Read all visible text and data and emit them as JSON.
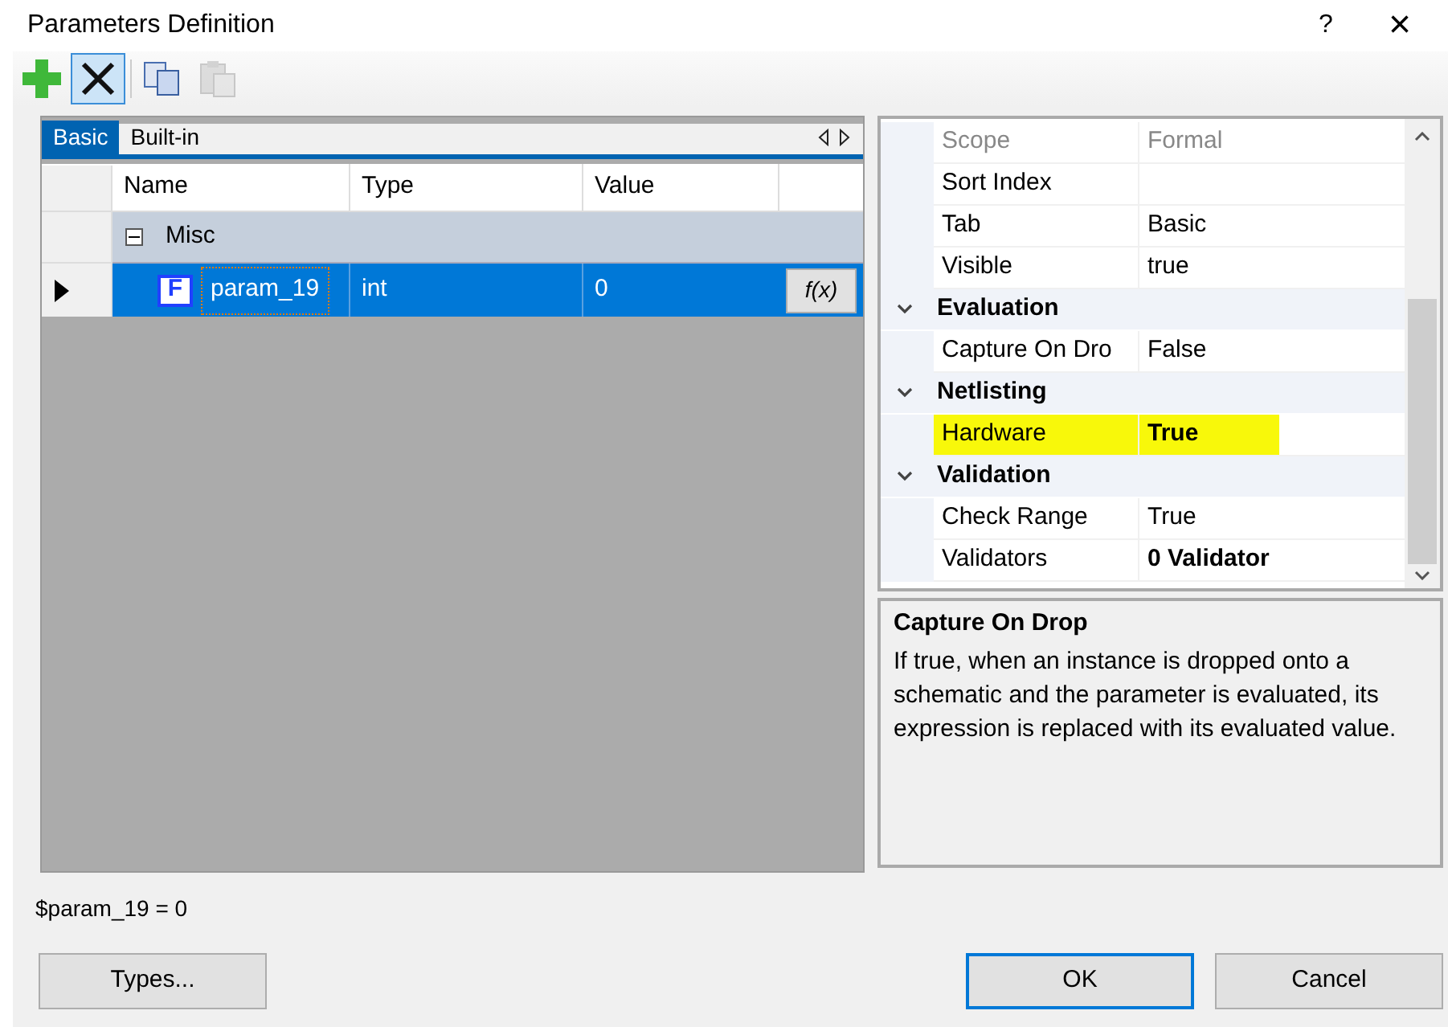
{
  "window": {
    "title": "Parameters Definition",
    "help": "?",
    "close": "×"
  },
  "toolbar": [
    {
      "kind": "add",
      "active": false,
      "disabled": false
    },
    {
      "kind": "delete",
      "active": true,
      "disabled": false
    },
    {
      "kind": "copy",
      "active": false,
      "disabled": false
    },
    {
      "kind": "paste",
      "active": false,
      "disabled": true
    }
  ],
  "tabs": [
    {
      "label": "Basic",
      "selected": true
    },
    {
      "label": "Built-in",
      "selected": false
    }
  ],
  "table": {
    "columns": [
      "Name",
      "Type",
      "Value"
    ],
    "groups": [
      {
        "label": "Misc",
        "expanded": true,
        "rows": [
          {
            "current": true,
            "selected": true,
            "badge": "F",
            "name": "param_19",
            "type": "int",
            "value": "0",
            "button": "f(x)"
          }
        ]
      }
    ]
  },
  "property_grid": {
    "rows": [
      {
        "kind": "property",
        "name": "Scope",
        "value": "Formal",
        "disabled": true
      },
      {
        "kind": "property",
        "name": "Sort Index"
      },
      {
        "kind": "property",
        "name": "Tab",
        "value": "Basic"
      },
      {
        "kind": "property",
        "name": "Visible",
        "value": "true"
      },
      {
        "kind": "category",
        "name": "Evaluation",
        "expanded": true
      },
      {
        "kind": "property",
        "name": "Capture On Dro",
        "value": "False"
      },
      {
        "kind": "category",
        "name": "Netlisting",
        "expanded": true
      },
      {
        "kind": "property",
        "name": "Hardware",
        "value": "True",
        "bold": true,
        "highlighted": true
      },
      {
        "kind": "category",
        "name": "Validation",
        "expanded": true
      },
      {
        "kind": "property",
        "name": "Check Range",
        "value": "True"
      },
      {
        "kind": "property",
        "name": "Validators",
        "value": "0 Validator",
        "bold": true
      }
    ],
    "description": {
      "title": "Capture On Drop",
      "text": "If true, when an instance is dropped onto a schematic and the parameter is evaluated, its expression is replaced with its evaluated value."
    }
  },
  "status": "$param_19 = 0",
  "buttons": [
    {
      "label": "Types...",
      "default": false
    },
    {
      "label": "OK",
      "default": true
    },
    {
      "label": "Cancel",
      "default": false
    }
  ]
}
